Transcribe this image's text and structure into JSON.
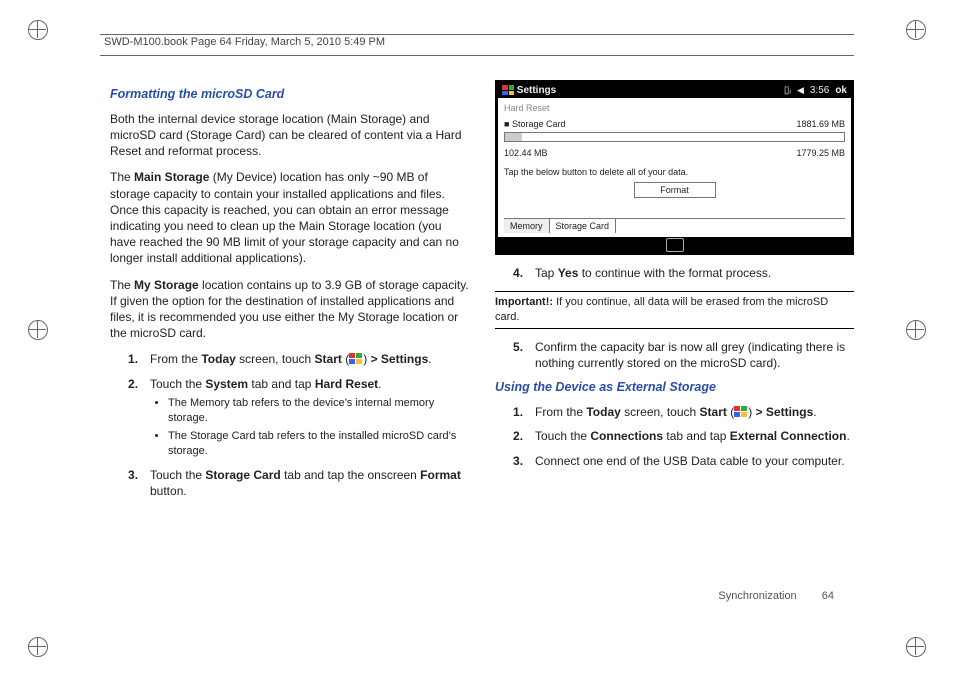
{
  "header": "SWD-M100.book  Page 64  Friday, March 5, 2010  5:49 PM",
  "sectionA": {
    "title": "Formatting the microSD Card",
    "p1": "Both the internal device storage location (Main Storage) and microSD card (Storage Card) can be cleared of content via a Hard Reset and reformat process.",
    "p2a": "The ",
    "p2b": "Main Storage",
    "p2c": " (My Device) location has only ~90 MB of storage capacity to contain your installed applications and files. Once this capacity is reached, you can obtain an error message indicating you need to clean up the Main Storage location (you have reached the 90 MB limit of your storage capacity and can no longer install additional applications).",
    "p3a": "The ",
    "p3b": "My Storage",
    "p3c": " location contains up to 3.9 GB of storage capacity. If given the option for the destination of installed applications and files, it is recommended you use either the My Storage location or the microSD card.",
    "step1a": "From the ",
    "step1b": "Today",
    "step1c": " screen, touch ",
    "step1d": "Start",
    "step1e": " (",
    "step1f": ") ",
    "step1g": "> Settings",
    "step1h": ".",
    "step2a": "Touch the ",
    "step2b": "System",
    "step2c": " tab and tap ",
    "step2d": "Hard Reset",
    "step2e": ".",
    "bullet1": "The Memory tab refers to the device's internal memory storage.",
    "bullet2": "The Storage Card tab refers to the installed microSD card's storage.",
    "step3a": "Touch the ",
    "step3b": "Storage Card",
    "step3c": " tab and tap the onscreen ",
    "step3d": "Format",
    "step3e": " button."
  },
  "screenshot": {
    "title": "Settings",
    "time": "3:56",
    "ok": "ok",
    "hard_reset": "Hard Reset",
    "row1_label": "Storage Card",
    "row1_val": "1881.69 MB",
    "row2_left": "102.44 MB",
    "row2_right": "1779.25 MB",
    "msg": "Tap the below button to delete all of your data.",
    "format_btn": "Format",
    "tab1": "Memory",
    "tab2": "Storage Card"
  },
  "right": {
    "step4a": "Tap ",
    "step4b": "Yes",
    "step4c": " to continue with the format process.",
    "important_label": "Important!:",
    "important_text": " If you continue, all data will be erased from the microSD card.",
    "step5": "Confirm the capacity bar is now all grey (indicating there is nothing currently stored on the microSD card)."
  },
  "sectionB": {
    "title": "Using the Device as External Storage",
    "step1a": "From the ",
    "step1b": "Today",
    "step1c": " screen, touch ",
    "step1d": "Start",
    "step1e": " (",
    "step1f": ") ",
    "step1g": "> Settings",
    "step1h": ".",
    "step2a": "Touch the ",
    "step2b": "Connections",
    "step2c": " tab and tap ",
    "step2d": "External Connection",
    "step2e": ".",
    "step3": "Connect one end of the USB Data cable to your computer."
  },
  "footer": {
    "section": "Synchronization",
    "page": "64"
  }
}
